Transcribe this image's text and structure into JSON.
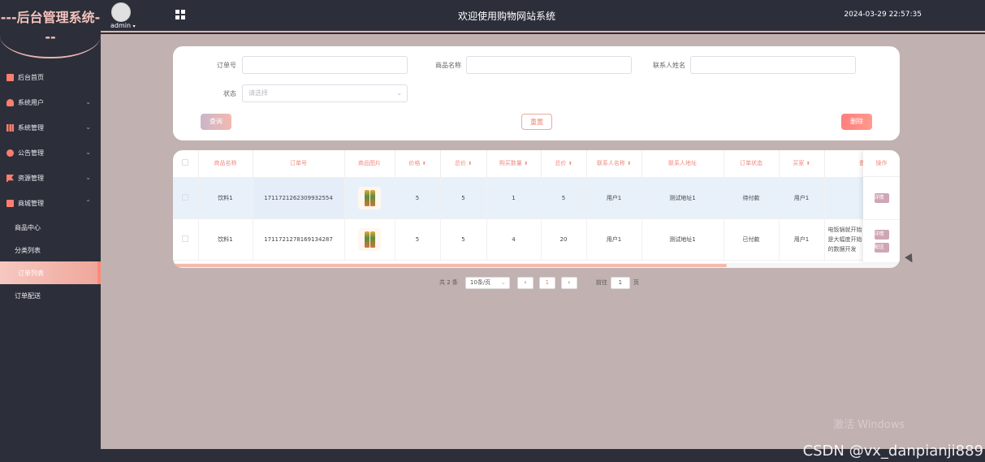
{
  "sidebar": {
    "logo": "---后台管理系统---",
    "items": [
      {
        "label": "后台首页",
        "icon": "monitor-icon",
        "has_arrow": false
      },
      {
        "label": "系统用户",
        "icon": "user-icon",
        "has_arrow": true
      },
      {
        "label": "系统管理",
        "icon": "chart-icon",
        "has_arrow": true
      },
      {
        "label": "公告管理",
        "icon": "info-icon",
        "has_arrow": true
      },
      {
        "label": "资源管理",
        "icon": "flag-icon",
        "has_arrow": true
      },
      {
        "label": "商城管理",
        "icon": "shop-icon",
        "has_arrow": true,
        "expanded": true
      }
    ],
    "submenu": [
      {
        "label": "商品中心"
      },
      {
        "label": "分类列表"
      },
      {
        "label": "订单列表",
        "active": true
      },
      {
        "label": "订单配送"
      }
    ]
  },
  "header": {
    "user": "admin",
    "title": "欢迎使用购物网站系统",
    "datetime": "2024-03-29 22:57:35"
  },
  "search": {
    "order_no_label": "订单号",
    "product_name_label": "商品名称",
    "contact_name_label": "联系人姓名",
    "status_label": "状态",
    "status_placeholder": "请选择",
    "query_button": "查询",
    "reset_button": "重置",
    "delete_button": "删除"
  },
  "table": {
    "headers": [
      "商品名称",
      "订单号",
      "商品图片",
      "价格",
      "总价",
      "购买数量",
      "总价",
      "联系人名称",
      "联系人地址",
      "订单状态",
      "买家",
      "备"
    ],
    "operation_header": "操作",
    "rows": [
      {
        "name": "饮料1",
        "order_no": "1711721262309932554",
        "price": "5",
        "price2": "5",
        "qty": "1",
        "total": "5",
        "contact": "用户1",
        "address": "测试地址1",
        "status": "待付款",
        "buyer": "用户1",
        "remark": "",
        "ops": [
          "详情"
        ]
      },
      {
        "name": "饮料1",
        "order_no": "1711721278169134287",
        "price": "5",
        "price2": "5",
        "qty": "4",
        "total": "20",
        "contact": "用户1",
        "address": "测试地址1",
        "status": "已付款",
        "buyer": "用户1",
        "remark": "电饭锅就开始\n是大幅度开始\n的数据开发",
        "ops": [
          "详情",
          "配送"
        ]
      }
    ]
  },
  "pagination": {
    "total": "共 2 条",
    "page_size": "10条/页",
    "current": "1",
    "goto_label": "前往",
    "goto_value": "1",
    "page_suffix": "页"
  },
  "watermark": "激活 Windows",
  "csdn": "CSDN @vx_danpianji889",
  "colors": {
    "accent": "#f08a7e",
    "sidebar_bg": "#2c2f3a",
    "content_bg": "#c1b1b1"
  }
}
